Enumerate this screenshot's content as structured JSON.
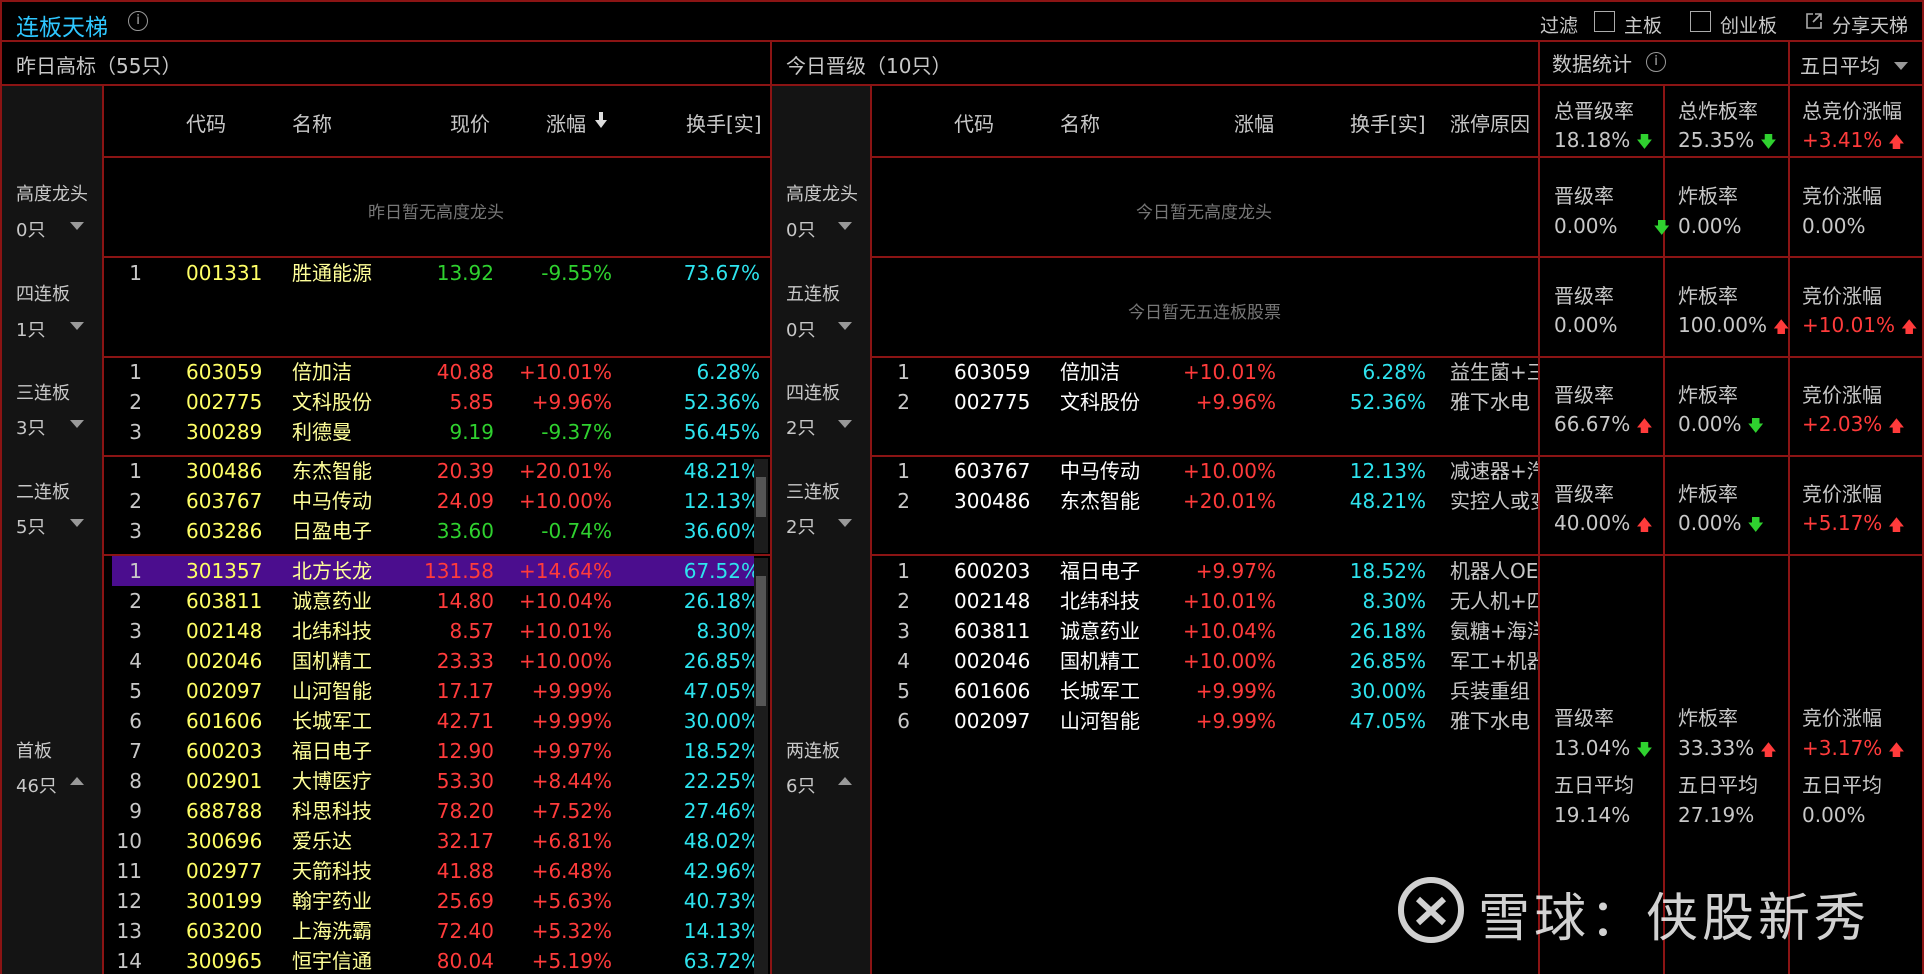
{
  "header": {
    "title": "连板天梯",
    "filter_label": "过滤",
    "filter_main": "主板",
    "filter_gem": "创业板",
    "share": "分享天梯"
  },
  "left_panel": {
    "title": "昨日高标（55只）",
    "columns": [
      "代码",
      "名称",
      "现价",
      "涨幅",
      "换手[实]"
    ],
    "sort_indicator": "涨幅"
  },
  "mid_panel": {
    "title": "今日晋级（10只）",
    "columns": [
      "代码",
      "名称",
      "涨幅",
      "换手[实]",
      "涨停原因"
    ]
  },
  "stats_panel": {
    "title": "数据统计",
    "period_select": "五日平均",
    "summary_labels": [
      "总晋级率",
      "总炸板率",
      "总竞价涨幅"
    ],
    "summary_values": [
      "18.18%",
      "25.35%",
      "+3.41%"
    ],
    "summary_arrows": [
      "down",
      "down",
      "up"
    ]
  },
  "levels": [
    {
      "left_name": "高度龙头",
      "left_count": "0只",
      "left_empty": "昨日暂无高度龙头",
      "mid_name": "高度龙头",
      "mid_count": "0只",
      "mid_empty": "今日暂无高度龙头",
      "stats": {
        "labels": [
          "晋级率",
          "炸板率",
          "竞价涨幅"
        ],
        "values": [
          "0.00%",
          "0.00%",
          "0.00%"
        ],
        "arrows": [
          "down",
          "",
          ""
        ]
      }
    },
    {
      "left_name": "四连板",
      "left_count": "1只",
      "mid_name": "五连板",
      "mid_count": "0只",
      "mid_empty": "今日暂无五连板股票",
      "stats": {
        "labels": [
          "晋级率",
          "炸板率",
          "竞价涨幅"
        ],
        "values": [
          "0.00%",
          "100.00%",
          "+10.01%"
        ],
        "arrows": [
          "",
          "up",
          "up"
        ]
      }
    },
    {
      "left_name": "三连板",
      "left_count": "3只",
      "mid_name": "四连板",
      "mid_count": "2只",
      "stats": {
        "labels": [
          "晋级率",
          "炸板率",
          "竞价涨幅"
        ],
        "values": [
          "66.67%",
          "0.00%",
          "+2.03%"
        ],
        "arrows": [
          "up",
          "down",
          "up"
        ]
      }
    },
    {
      "left_name": "二连板",
      "left_count": "5只",
      "mid_name": "三连板",
      "mid_count": "2只",
      "stats": {
        "labels": [
          "晋级率",
          "炸板率",
          "竞价涨幅"
        ],
        "values": [
          "40.00%",
          "0.00%",
          "+5.17%"
        ],
        "arrows": [
          "up",
          "down",
          "up"
        ]
      }
    },
    {
      "left_name": "首板",
      "left_count": "46只",
      "mid_name": "两连板",
      "mid_count": "6只",
      "stats": {
        "labels": [
          "晋级率",
          "炸板率",
          "竞价涨幅"
        ],
        "values": [
          "13.04%",
          "33.33%",
          "+3.17%"
        ],
        "arrows": [
          "down",
          "up",
          "up"
        ],
        "avg_label": "五日平均",
        "avg_values": [
          "19.14%",
          "27.19%",
          "0.00%"
        ]
      }
    }
  ],
  "left_rows": [
    {
      "idx": "1",
      "code": "001331",
      "name": "胜通能源",
      "price": "13.92",
      "chg": "-9.55%",
      "turn": "73.67%",
      "dir": "down"
    },
    {
      "idx": "1",
      "code": "603059",
      "name": "倍加洁",
      "price": "40.88",
      "chg": "+10.01%",
      "turn": "6.28%",
      "dir": "up"
    },
    {
      "idx": "2",
      "code": "002775",
      "name": "文科股份",
      "price": "5.85",
      "chg": "+9.96%",
      "turn": "52.36%",
      "dir": "up"
    },
    {
      "idx": "3",
      "code": "300289",
      "name": "利德曼",
      "price": "9.19",
      "chg": "-9.37%",
      "turn": "56.45%",
      "dir": "down"
    },
    {
      "idx": "1",
      "code": "300486",
      "name": "东杰智能",
      "price": "20.39",
      "chg": "+20.01%",
      "turn": "48.21%",
      "dir": "up"
    },
    {
      "idx": "2",
      "code": "603767",
      "name": "中马传动",
      "price": "24.09",
      "chg": "+10.00%",
      "turn": "12.13%",
      "dir": "up"
    },
    {
      "idx": "3",
      "code": "603286",
      "name": "日盈电子",
      "price": "33.60",
      "chg": "-0.74%",
      "turn": "36.60%",
      "dir": "down"
    },
    {
      "idx": "1",
      "code": "301357",
      "name": "北方长龙",
      "price": "131.58",
      "chg": "+14.64%",
      "turn": "67.52%",
      "dir": "up"
    },
    {
      "idx": "2",
      "code": "603811",
      "name": "诚意药业",
      "price": "14.80",
      "chg": "+10.04%",
      "turn": "26.18%",
      "dir": "up"
    },
    {
      "idx": "3",
      "code": "002148",
      "name": "北纬科技",
      "price": "8.57",
      "chg": "+10.01%",
      "turn": "8.30%",
      "dir": "up"
    },
    {
      "idx": "4",
      "code": "002046",
      "name": "国机精工",
      "price": "23.33",
      "chg": "+10.00%",
      "turn": "26.85%",
      "dir": "up"
    },
    {
      "idx": "5",
      "code": "002097",
      "name": "山河智能",
      "price": "17.17",
      "chg": "+9.99%",
      "turn": "47.05%",
      "dir": "up"
    },
    {
      "idx": "6",
      "code": "601606",
      "name": "长城军工",
      "price": "42.71",
      "chg": "+9.99%",
      "turn": "30.00%",
      "dir": "up"
    },
    {
      "idx": "7",
      "code": "600203",
      "name": "福日电子",
      "price": "12.90",
      "chg": "+9.97%",
      "turn": "18.52%",
      "dir": "up"
    },
    {
      "idx": "8",
      "code": "002901",
      "name": "大博医疗",
      "price": "53.30",
      "chg": "+8.44%",
      "turn": "22.25%",
      "dir": "up"
    },
    {
      "idx": "9",
      "code": "688788",
      "name": "科思科技",
      "price": "78.20",
      "chg": "+7.52%",
      "turn": "27.46%",
      "dir": "up"
    },
    {
      "idx": "10",
      "code": "300696",
      "name": "爱乐达",
      "price": "32.17",
      "chg": "+6.81%",
      "turn": "48.02%",
      "dir": "up"
    },
    {
      "idx": "11",
      "code": "002977",
      "name": "天箭科技",
      "price": "41.88",
      "chg": "+6.48%",
      "turn": "42.96%",
      "dir": "up"
    },
    {
      "idx": "12",
      "code": "300199",
      "name": "翰宇药业",
      "price": "25.69",
      "chg": "+5.63%",
      "turn": "40.73%",
      "dir": "up"
    },
    {
      "idx": "13",
      "code": "603200",
      "name": "上海洗霸",
      "price": "72.40",
      "chg": "+5.32%",
      "turn": "14.13%",
      "dir": "up"
    },
    {
      "idx": "14",
      "code": "300965",
      "name": "恒宇信通",
      "price": "80.04",
      "chg": "+5.19%",
      "turn": "63.72%",
      "dir": "up"
    }
  ],
  "mid_rows": [
    {
      "idx": "1",
      "code": "603059",
      "name": "倍加洁",
      "chg": "+10.01%",
      "turn": "6.28%",
      "reason": "益生菌+三"
    },
    {
      "idx": "2",
      "code": "002775",
      "name": "文科股份",
      "chg": "+9.96%",
      "turn": "52.36%",
      "reason": "雅下水电"
    },
    {
      "idx": "1",
      "code": "603767",
      "name": "中马传动",
      "chg": "+10.00%",
      "turn": "12.13%",
      "reason": "减速器+汽"
    },
    {
      "idx": "2",
      "code": "300486",
      "name": "东杰智能",
      "chg": "+20.01%",
      "turn": "48.21%",
      "reason": "实控人或变"
    },
    {
      "idx": "1",
      "code": "600203",
      "name": "福日电子",
      "chg": "+9.97%",
      "turn": "18.52%",
      "reason": "机器人OE"
    },
    {
      "idx": "2",
      "code": "002148",
      "name": "北纬科技",
      "chg": "+10.01%",
      "turn": "8.30%",
      "reason": "无人机+四"
    },
    {
      "idx": "3",
      "code": "603811",
      "name": "诚意药业",
      "chg": "+10.04%",
      "turn": "26.18%",
      "reason": "氨糖+海洋"
    },
    {
      "idx": "4",
      "code": "002046",
      "name": "国机精工",
      "chg": "+10.00%",
      "turn": "26.85%",
      "reason": "军工+机器"
    },
    {
      "idx": "5",
      "code": "601606",
      "name": "长城军工",
      "chg": "+9.99%",
      "turn": "30.00%",
      "reason": "兵装重组"
    },
    {
      "idx": "6",
      "code": "002097",
      "name": "山河智能",
      "chg": "+9.99%",
      "turn": "47.05%",
      "reason": "雅下水电"
    }
  ],
  "watermark": "雪球：侠股新秀",
  "colors": {
    "accent": "#2ec7ff",
    "border": "#8b1414",
    "up": "#ff3b3b",
    "down": "#2fd12f",
    "turnover": "#2ee3ee",
    "selected": "#4b0d8e"
  }
}
